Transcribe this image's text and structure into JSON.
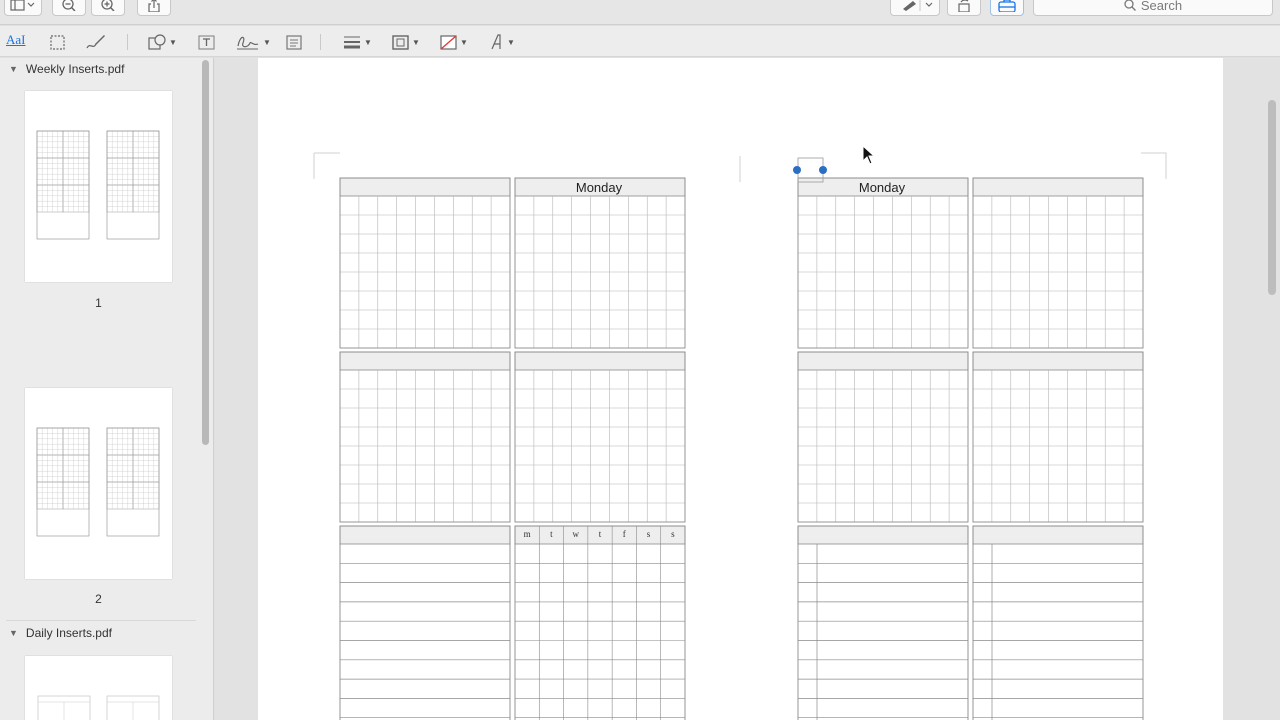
{
  "toolbar": {
    "search_placeholder": "Search",
    "icons": [
      "sidebar-view-icon",
      "zoom-out-icon",
      "zoom-in-icon",
      "share-icon",
      "highlight-pen-icon",
      "rotate-icon",
      "markup-toolbox-icon",
      "search-icon"
    ]
  },
  "markup_toolbar": {
    "text_selection_label": "AaI",
    "tools": [
      "rect-selection",
      "sketch",
      "shapes",
      "text-box",
      "signature",
      "note",
      "line-style",
      "border-color",
      "fill-color",
      "text-style"
    ]
  },
  "sidebar": {
    "documents": [
      {
        "name": "Weekly Inserts.pdf",
        "pages": [
          "1",
          "2"
        ]
      },
      {
        "name": "Daily Inserts.pdf",
        "pages": []
      }
    ]
  },
  "document": {
    "left_day_header": "Monday",
    "right_day_header": "Monday",
    "habit_days": [
      "m",
      "t",
      "w",
      "t",
      "f",
      "s",
      "s"
    ]
  },
  "colors": {
    "accent": "#1a73e8",
    "selection_handle": "#2a6fc4",
    "grid_line": "#b5b5b5",
    "box_border": "#8a8a8a",
    "header_fill": "#eeeeee"
  }
}
